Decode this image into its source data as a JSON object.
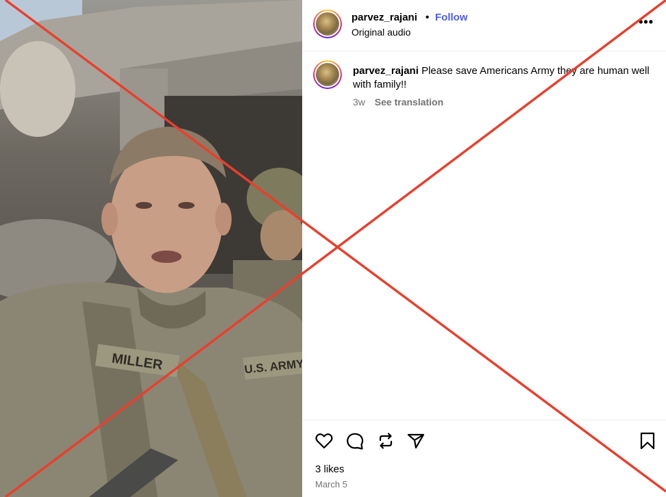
{
  "post": {
    "username": "parvez_rajani",
    "separator": "•",
    "follow_label": "Follow",
    "audio_label": "Original audio",
    "more_label": "•••"
  },
  "comment": {
    "username": "parvez_rajani",
    "text": "Please save Americans Army they are human well with family!!",
    "age": "3w",
    "translate_label": "See translation"
  },
  "footer": {
    "likes": "3 likes",
    "date": "March 5"
  },
  "media": {
    "name_tape": "MILLER",
    "branch_tape": "U.S. ARMY"
  },
  "icons": {
    "like": "heart-icon",
    "comment": "comment-icon",
    "repost": "repost-icon",
    "share": "share-icon",
    "save": "bookmark-icon"
  },
  "colors": {
    "accent": "#4a5df9",
    "overlay_x": "#e8402e",
    "muted": "#737373"
  }
}
